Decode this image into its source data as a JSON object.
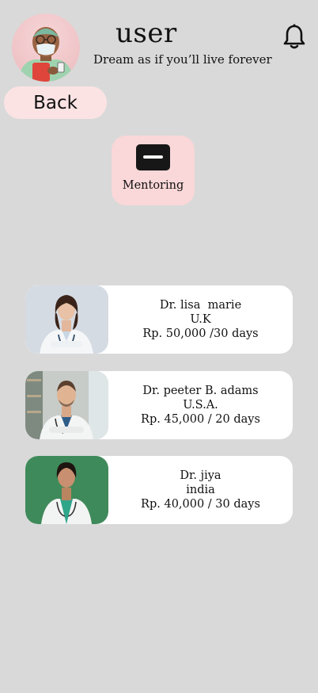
{
  "header": {
    "username": "user",
    "tagline": "Dream as if you’ll live forever",
    "notification_icon": "bell-icon"
  },
  "nav": {
    "back_label": "Back"
  },
  "categories": [
    {
      "label": "Mentoring",
      "icon": "minus-square-icon"
    }
  ],
  "doctors": [
    {
      "name": "Dr. lisa  marie",
      "country": "U.K",
      "price": "Rp. 50,000 /30 days"
    },
    {
      "name": "Dr. peeter B. adams",
      "country": "U.S.A.",
      "price": "Rp. 45,000 / 20 days"
    },
    {
      "name": "Dr. jiya",
      "country": "india",
      "price": "Rp. 40,000 / 30 days"
    }
  ],
  "colors": {
    "background": "#d9d9d9",
    "back_button": "#fbe3e4",
    "category_tile": "#fad7d8",
    "card": "#ffffff"
  }
}
